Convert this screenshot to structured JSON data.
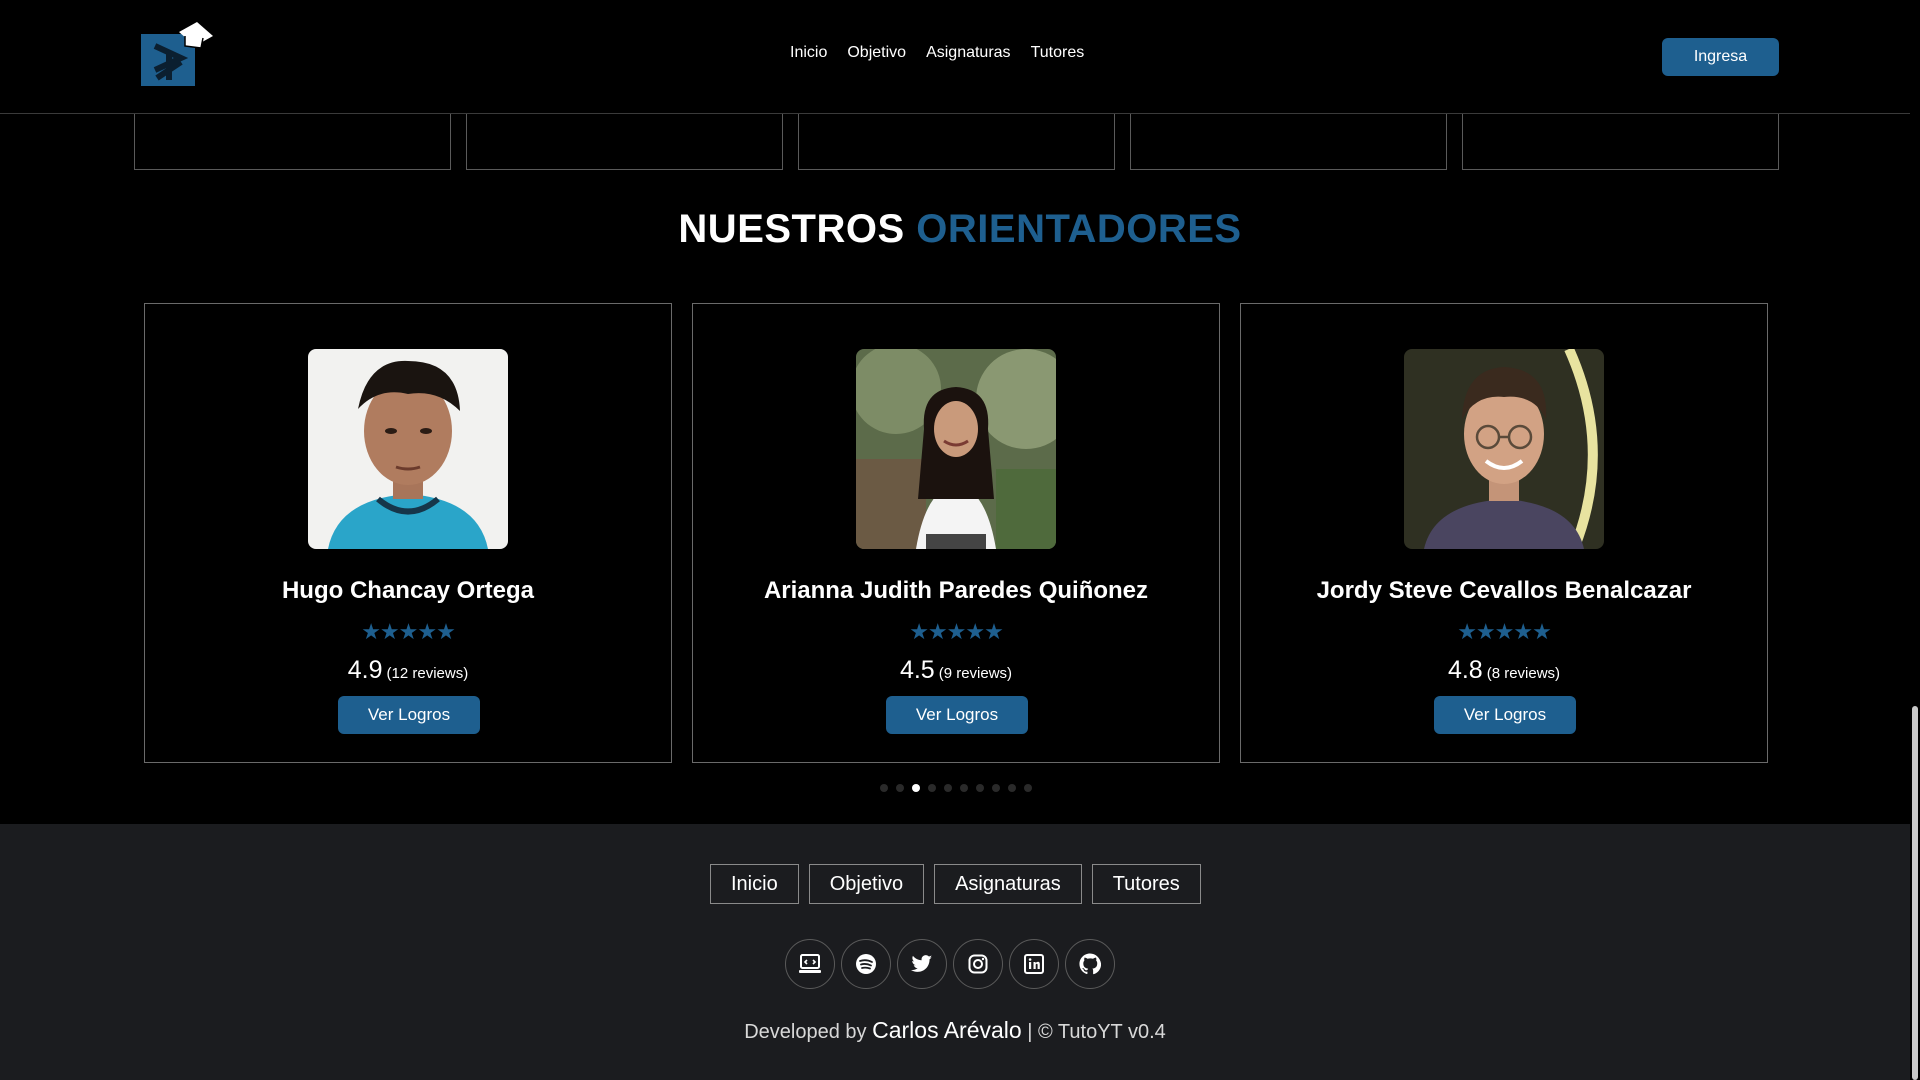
{
  "nav": {
    "links": [
      "Inicio",
      "Objetivo",
      "Asignaturas",
      "Tutores"
    ],
    "login_label": "Ingresa"
  },
  "section": {
    "title_main": "NUESTROS",
    "title_accent": "ORIENTADORES"
  },
  "tutors": [
    {
      "name": "Hugo Chancay Ortega",
      "stars": "★★★★★",
      "rating": "4.9",
      "reviews": "(12 reviews)",
      "button": "Ver Logros"
    },
    {
      "name": "Arianna Judith Paredes Quiñonez",
      "stars": "★★★★★",
      "rating": "4.5",
      "reviews": "(9 reviews)",
      "button": "Ver Logros"
    },
    {
      "name": "Jordy Steve Cevallos Benalcazar",
      "stars": "★★★★★",
      "rating": "4.8",
      "reviews": "(8 reviews)",
      "button": "Ver Logros"
    }
  ],
  "carousel": {
    "dot_count": 10,
    "active_index": 2
  },
  "footer": {
    "links": [
      "Inicio",
      "Objetivo",
      "Asignaturas",
      "Tutores"
    ],
    "socials": [
      "website-icon",
      "spotify-icon",
      "twitter-icon",
      "instagram-icon",
      "linkedin-icon",
      "github-icon"
    ],
    "credit_prefix": "Developed by",
    "author": "Carlos Arévalo",
    "credit_suffix": "| © TutoYT v0.4"
  },
  "colors": {
    "accent": "#1e5f8f",
    "background": "#000000",
    "footer_bg": "#1b1c1f"
  }
}
